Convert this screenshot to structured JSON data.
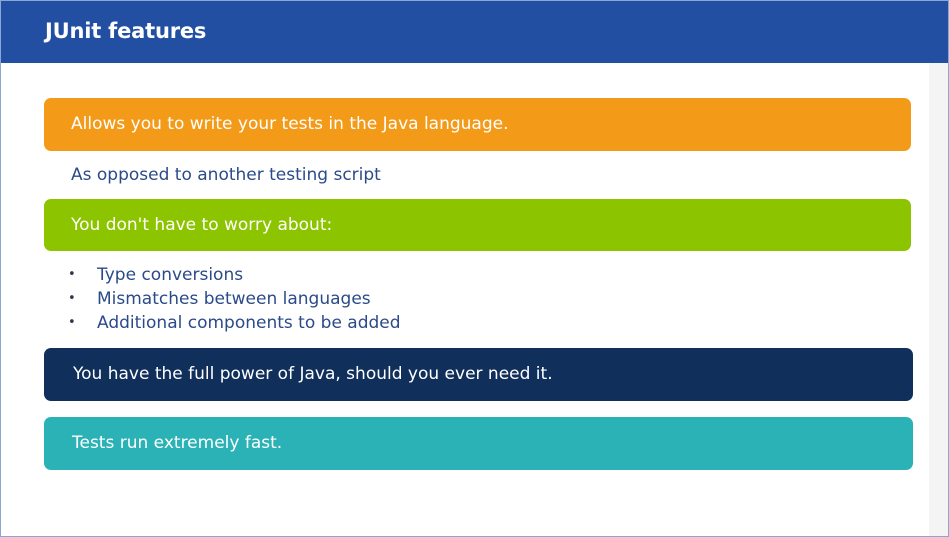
{
  "header": {
    "title": "JUnit features"
  },
  "items": {
    "write_tests": "Allows you to write your tests in the Java language.",
    "opposed": "As opposed to another testing script",
    "no_worry": "You don't have to worry about:",
    "bullet_glyph": "•",
    "bullets": [
      "Type conversions",
      "Mismatches between languages",
      "Additional components to be added"
    ],
    "full_power": "You have the full power of Java, should you ever need it.",
    "fast": "Tests run extremely fast."
  },
  "colors": {
    "header_blue": "#234fa3",
    "orange": "#f39a19",
    "green": "#8cc400",
    "navy": "#102f5b",
    "teal": "#2ab2b7",
    "body_text": "#2a4a8a"
  }
}
